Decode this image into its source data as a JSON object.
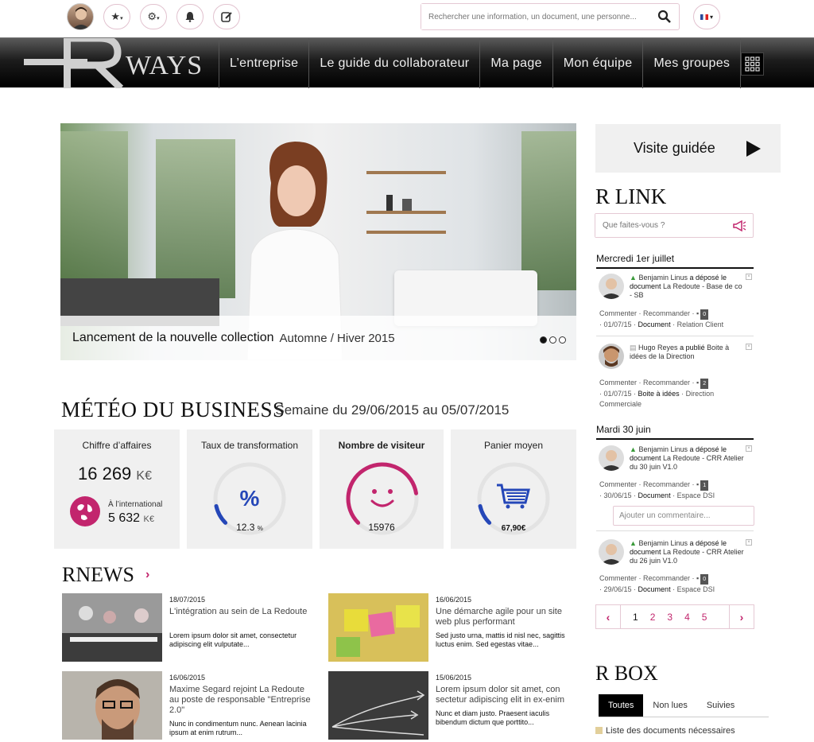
{
  "topbar": {
    "search_placeholder": "Rechercher une information, un document, une personne...",
    "icons": [
      "star-icon",
      "settings-icon",
      "bell-icon",
      "edit-icon",
      "search-icon",
      "flag-fr-icon"
    ]
  },
  "brand": {
    "logo_text": "WAYS",
    "accent": "#c2256d"
  },
  "nav": {
    "items": [
      "L’entreprise",
      "Le guide du collaborateur",
      "Ma page",
      "Mon équipe",
      "Mes groupes"
    ]
  },
  "hero": {
    "caption_main": "Lancement de la nouvelle collection",
    "caption_sub": "Automne / Hiver 2015",
    "slides": 3,
    "active_slide": 1
  },
  "meteo": {
    "title": "MÉTÉO DU BUSINESS",
    "subtitle": "- Semaine du 29/06/2015 au 05/07/2015",
    "kpis": [
      {
        "title": "Chiffre d’affaires",
        "value": "16 269",
        "unit": "K€",
        "intl_label": "À l’international",
        "intl_value": "5 632",
        "intl_unit": "K€"
      },
      {
        "title": "Taux de transformation",
        "value": "12.3",
        "unit": "%",
        "symbol": "%",
        "level": 0.12
      },
      {
        "title": "Nombre de visiteur",
        "value": "15976",
        "level": 0.8
      },
      {
        "title": "Panier moyen",
        "value": "67,90€",
        "level": 0.12
      }
    ]
  },
  "rnews": {
    "title": "RNEWS",
    "items": [
      {
        "date": "18/07/2015",
        "headline": "L'intégration au sein de La Redoute",
        "body": "Lorem ipsum dolor sit amet, consectetur adipiscing elit vulputate..."
      },
      {
        "date": "16/06/2015",
        "headline": "Une démarche agile pour un site web plus performant",
        "body": "Sed justo urna, mattis id nisl nec, sagittis luctus enim. Sed egestas vitae..."
      },
      {
        "date": "16/06/2015",
        "headline": "Maxime Segard rejoint La Redoute au poste de responsable \"Entreprise 2.0\"",
        "body": "Nunc in condimentum nunc. Aenean lacinia ipsum at enim rutrum..."
      },
      {
        "date": "15/06/2015",
        "headline": "Lorem ipsum dolor sit amet, con sectetur adipiscing elit in ex-enim",
        "body": "Nunc et diam justo. Praesent iaculis bibendum dictum que porttito..."
      }
    ]
  },
  "visite": {
    "label": "Visite guidée"
  },
  "rlink": {
    "title": "R LINK",
    "placeholder": "Que faites-vous ?",
    "days": [
      "Mercredi 1er juillet",
      "Mardi 30 juin"
    ],
    "feed": [
      {
        "user": "Benjamin Linus",
        "action": "a déposé le document",
        "object": "La Redoute - Base de co - SB",
        "meta1": "Commenter · Recommander ·",
        "count": "0",
        "meta2_date": "01/07/15",
        "meta2_type": "Document",
        "meta2_tag": "Relation Client"
      },
      {
        "user": "Hugo Reyes",
        "action": "a publié",
        "object": "Boite à idées de la Direction",
        "meta1": "Commenter · Recommander ·",
        "count": "2",
        "meta2_date": "01/07/15",
        "meta2_type": "Boite à idées",
        "meta2_tag": "Direction Commerciale"
      },
      {
        "user": "Benjamin Linus",
        "action": "a déposé le document",
        "object": "La Redoute - CRR Atelier du 30 juin V1.0",
        "meta1": "Commenter · Recommander ·",
        "count": "1",
        "meta2_date": "30/06/15",
        "meta2_type": "Document",
        "meta2_tag": "Espace DSI"
      },
      {
        "user": "Benjamin Linus",
        "action": "a déposé le document",
        "object": "La Redoute - CRR Atelier du 26 juin V1.0",
        "meta1": "Commenter · Recommander ·",
        "count": "0",
        "meta2_date": "29/06/15",
        "meta2_type": "Document",
        "meta2_tag": "Espace DSI"
      }
    ],
    "comment_placeholder": "Ajouter un commentaire...",
    "pages": [
      "1",
      "2",
      "3",
      "4",
      "5"
    ],
    "current_page": "1"
  },
  "rbox": {
    "title": "R BOX",
    "tabs": [
      "Toutes",
      "Non lues",
      "Suivies"
    ],
    "first_item": "Liste des documents nécessaires"
  }
}
